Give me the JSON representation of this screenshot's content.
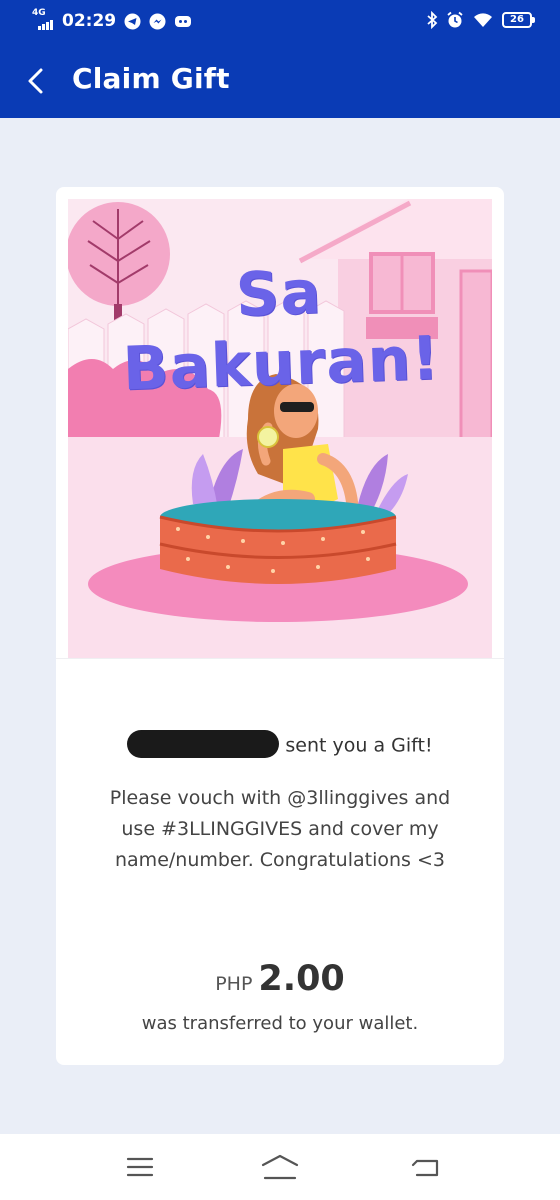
{
  "status_bar": {
    "network": "4G",
    "time": "02:29",
    "notification_icons": [
      "telegram-icon",
      "messenger-icon",
      "discord-icon"
    ],
    "right_icons": [
      "bluetooth-icon",
      "alarm-icon",
      "wifi-icon"
    ],
    "battery_level": "26"
  },
  "header": {
    "title": "Claim Gift",
    "back_icon": "chevron-left-icon"
  },
  "gift": {
    "card_title": "Sa Bakuran!",
    "sender_suffix": "sent you a Gift!",
    "message": "Please vouch with @3llinggives and use #3LLINGGIVES and cover my name/number. Congratulations <3",
    "currency": "PHP",
    "amount": "2.00",
    "transfer_note": "was transferred to your wallet."
  },
  "colors": {
    "primary": "#0a3bb5",
    "background": "#eaeef7",
    "art_title": "#6a63e8"
  },
  "nav_bar": {
    "items": [
      "menu-icon",
      "home-icon",
      "back-icon"
    ]
  }
}
